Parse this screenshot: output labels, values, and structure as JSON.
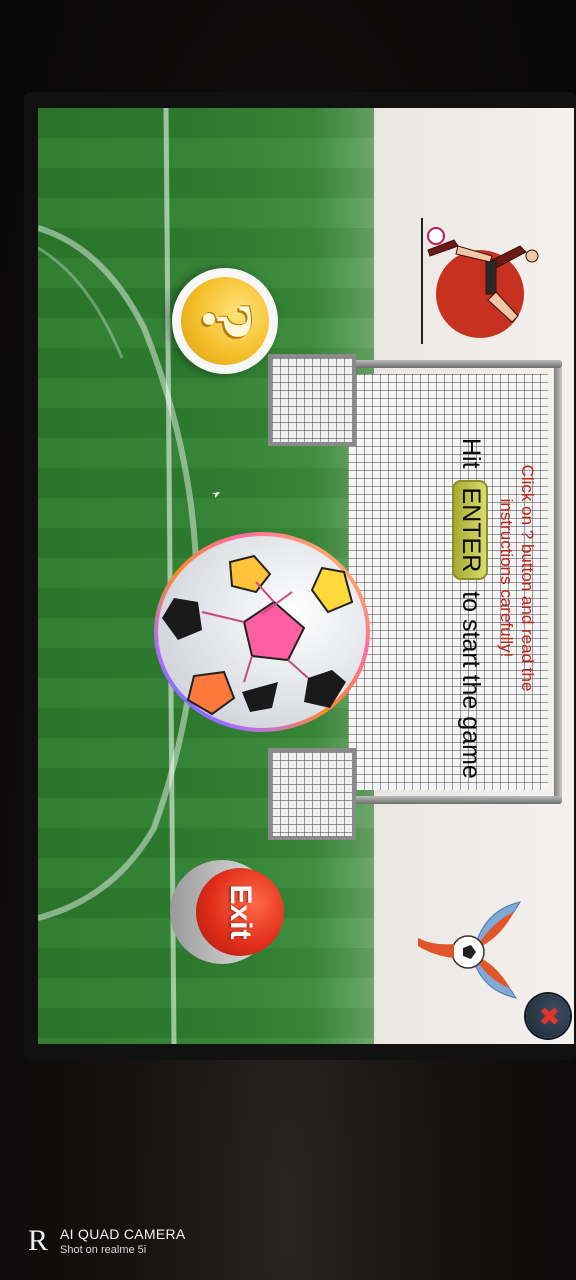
{
  "game": {
    "instruction_text": "Click on ? button and read the instructions carefully!",
    "hit_prefix": "Hit",
    "enter_key": "ENTER",
    "hit_suffix": "to start the game",
    "help_button_label": "?",
    "exit_button_label": "Exit",
    "close_button_label": "✖"
  },
  "colors": {
    "instruction": "#c0241d",
    "enter_key": "#c3c64a",
    "help_button": "#f4bf2a",
    "exit_button": "#e12d1a",
    "close_button": "#1b2733"
  },
  "icons": [
    "question-mark-icon",
    "soccer-ball-icon",
    "kicker-icon",
    "winged-ball-logo-icon",
    "close-icon",
    "cursor-icon"
  ],
  "camera_watermark": {
    "logo": "R",
    "title": "AI QUAD CAMERA",
    "subtitle": "Shot on realme 5i"
  }
}
